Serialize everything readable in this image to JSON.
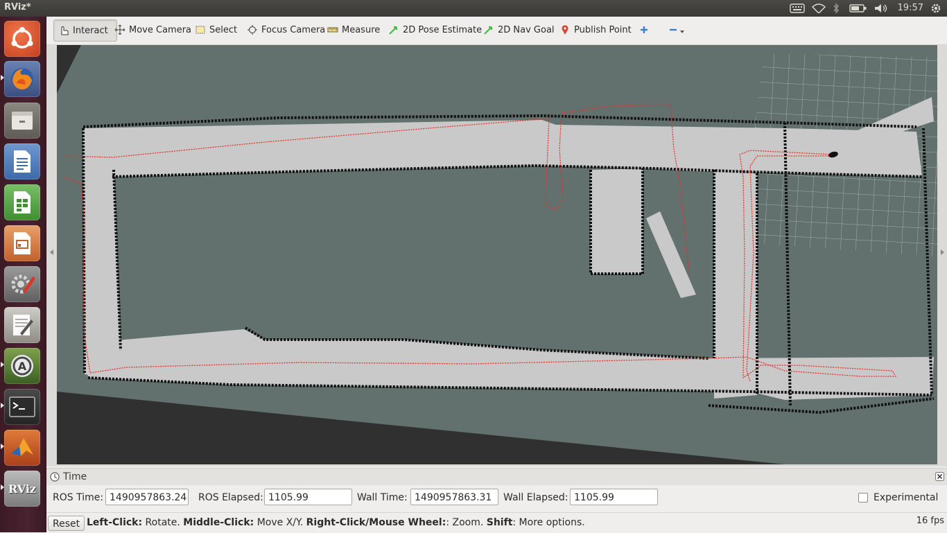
{
  "window": {
    "title": "RViz*",
    "clock": "19:57"
  },
  "launcher": {
    "apps": [
      {
        "name": "ubuntu-dash"
      },
      {
        "name": "firefox"
      },
      {
        "name": "files"
      },
      {
        "name": "writer"
      },
      {
        "name": "calc"
      },
      {
        "name": "impress"
      },
      {
        "name": "system-settings"
      },
      {
        "name": "text-editor"
      },
      {
        "name": "software-updater"
      },
      {
        "name": "terminal"
      },
      {
        "name": "matlab"
      },
      {
        "name": "rviz",
        "label": "RViz"
      }
    ]
  },
  "toolbar": {
    "interact": "Interact",
    "move_camera": "Move Camera",
    "select": "Select",
    "focus_camera": "Focus Camera",
    "measure": "Measure",
    "pose_estimate": "2D Pose Estimate",
    "nav_goal": "2D Nav Goal",
    "publish_point": "Publish Point"
  },
  "time_panel": {
    "title": "Time",
    "ros_time_label": "ROS Time:",
    "ros_time": "1490957863.24",
    "ros_elapsed_label": "ROS Elapsed:",
    "ros_elapsed": "1105.99",
    "wall_time_label": "Wall Time:",
    "wall_time": "1490957863.31",
    "wall_elapsed_label": "Wall Elapsed:",
    "wall_elapsed": "1105.99",
    "experimental_label": "Experimental"
  },
  "status": {
    "reset": "Reset",
    "hint_left": "Left-Click:",
    "hint_left_txt": " Rotate. ",
    "hint_mid": "Middle-Click:",
    "hint_mid_txt": " Move X/Y. ",
    "hint_right": "Right-Click/Mouse Wheel:",
    "hint_right_txt": ": Zoom. ",
    "hint_shift": "Shift",
    "hint_shift_txt": ": More options.",
    "fps": "16 fps"
  },
  "colors": {
    "path": "#e8322b",
    "free_space": "#c9c9c9",
    "unknown": "#62706e",
    "wall": "#111111",
    "grid": "#b9c0bf"
  }
}
